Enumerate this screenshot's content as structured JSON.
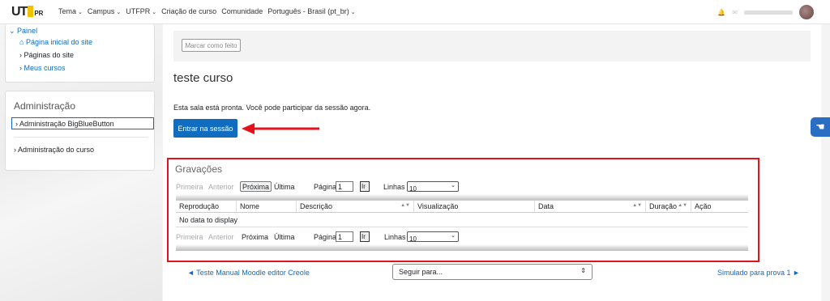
{
  "navbar": {
    "logo_main": "UT",
    "logo_suffix": "PR",
    "menu": [
      "Tema",
      "Campus",
      "UTFPR",
      "Criação de curso",
      "Comunidade",
      "Português - Brasil (pt_br)"
    ]
  },
  "nav_block": {
    "painel": "Painel",
    "home": "Página inicial do site",
    "pages": "Páginas do site",
    "courses": "Meus cursos"
  },
  "admin_block": {
    "title": "Administração",
    "item_bbb": "Administração BigBlueButton",
    "item_course": "Administração do curso"
  },
  "main": {
    "mark_done": "Marcar como feito",
    "title": "teste curso",
    "session_text": "Esta sala está pronta. Você pode participar da sessão agora.",
    "join_button": "Entrar na sessão"
  },
  "recordings": {
    "title": "Gravações",
    "pager": {
      "first": "Primeira",
      "prev": "Anterior",
      "next": "Próxima",
      "last": "Última",
      "page_label": "Página",
      "page_value": "1",
      "go": "Ir",
      "rows_label": "Linhas",
      "rows_value": "10"
    },
    "columns": [
      "Reprodução",
      "Nome",
      "Descrição",
      "Visualização",
      "Data",
      "Duração",
      "Ação"
    ],
    "empty": "No data to display"
  },
  "footer": {
    "prev_link": "◄ Teste Manual Moodle editor Creole",
    "jump_placeholder": "Seguir para...",
    "next_link": "Simulado para prova 1 ►"
  },
  "colors": {
    "accent": "#0f6cbf",
    "highlight_red": "#e3131b"
  }
}
